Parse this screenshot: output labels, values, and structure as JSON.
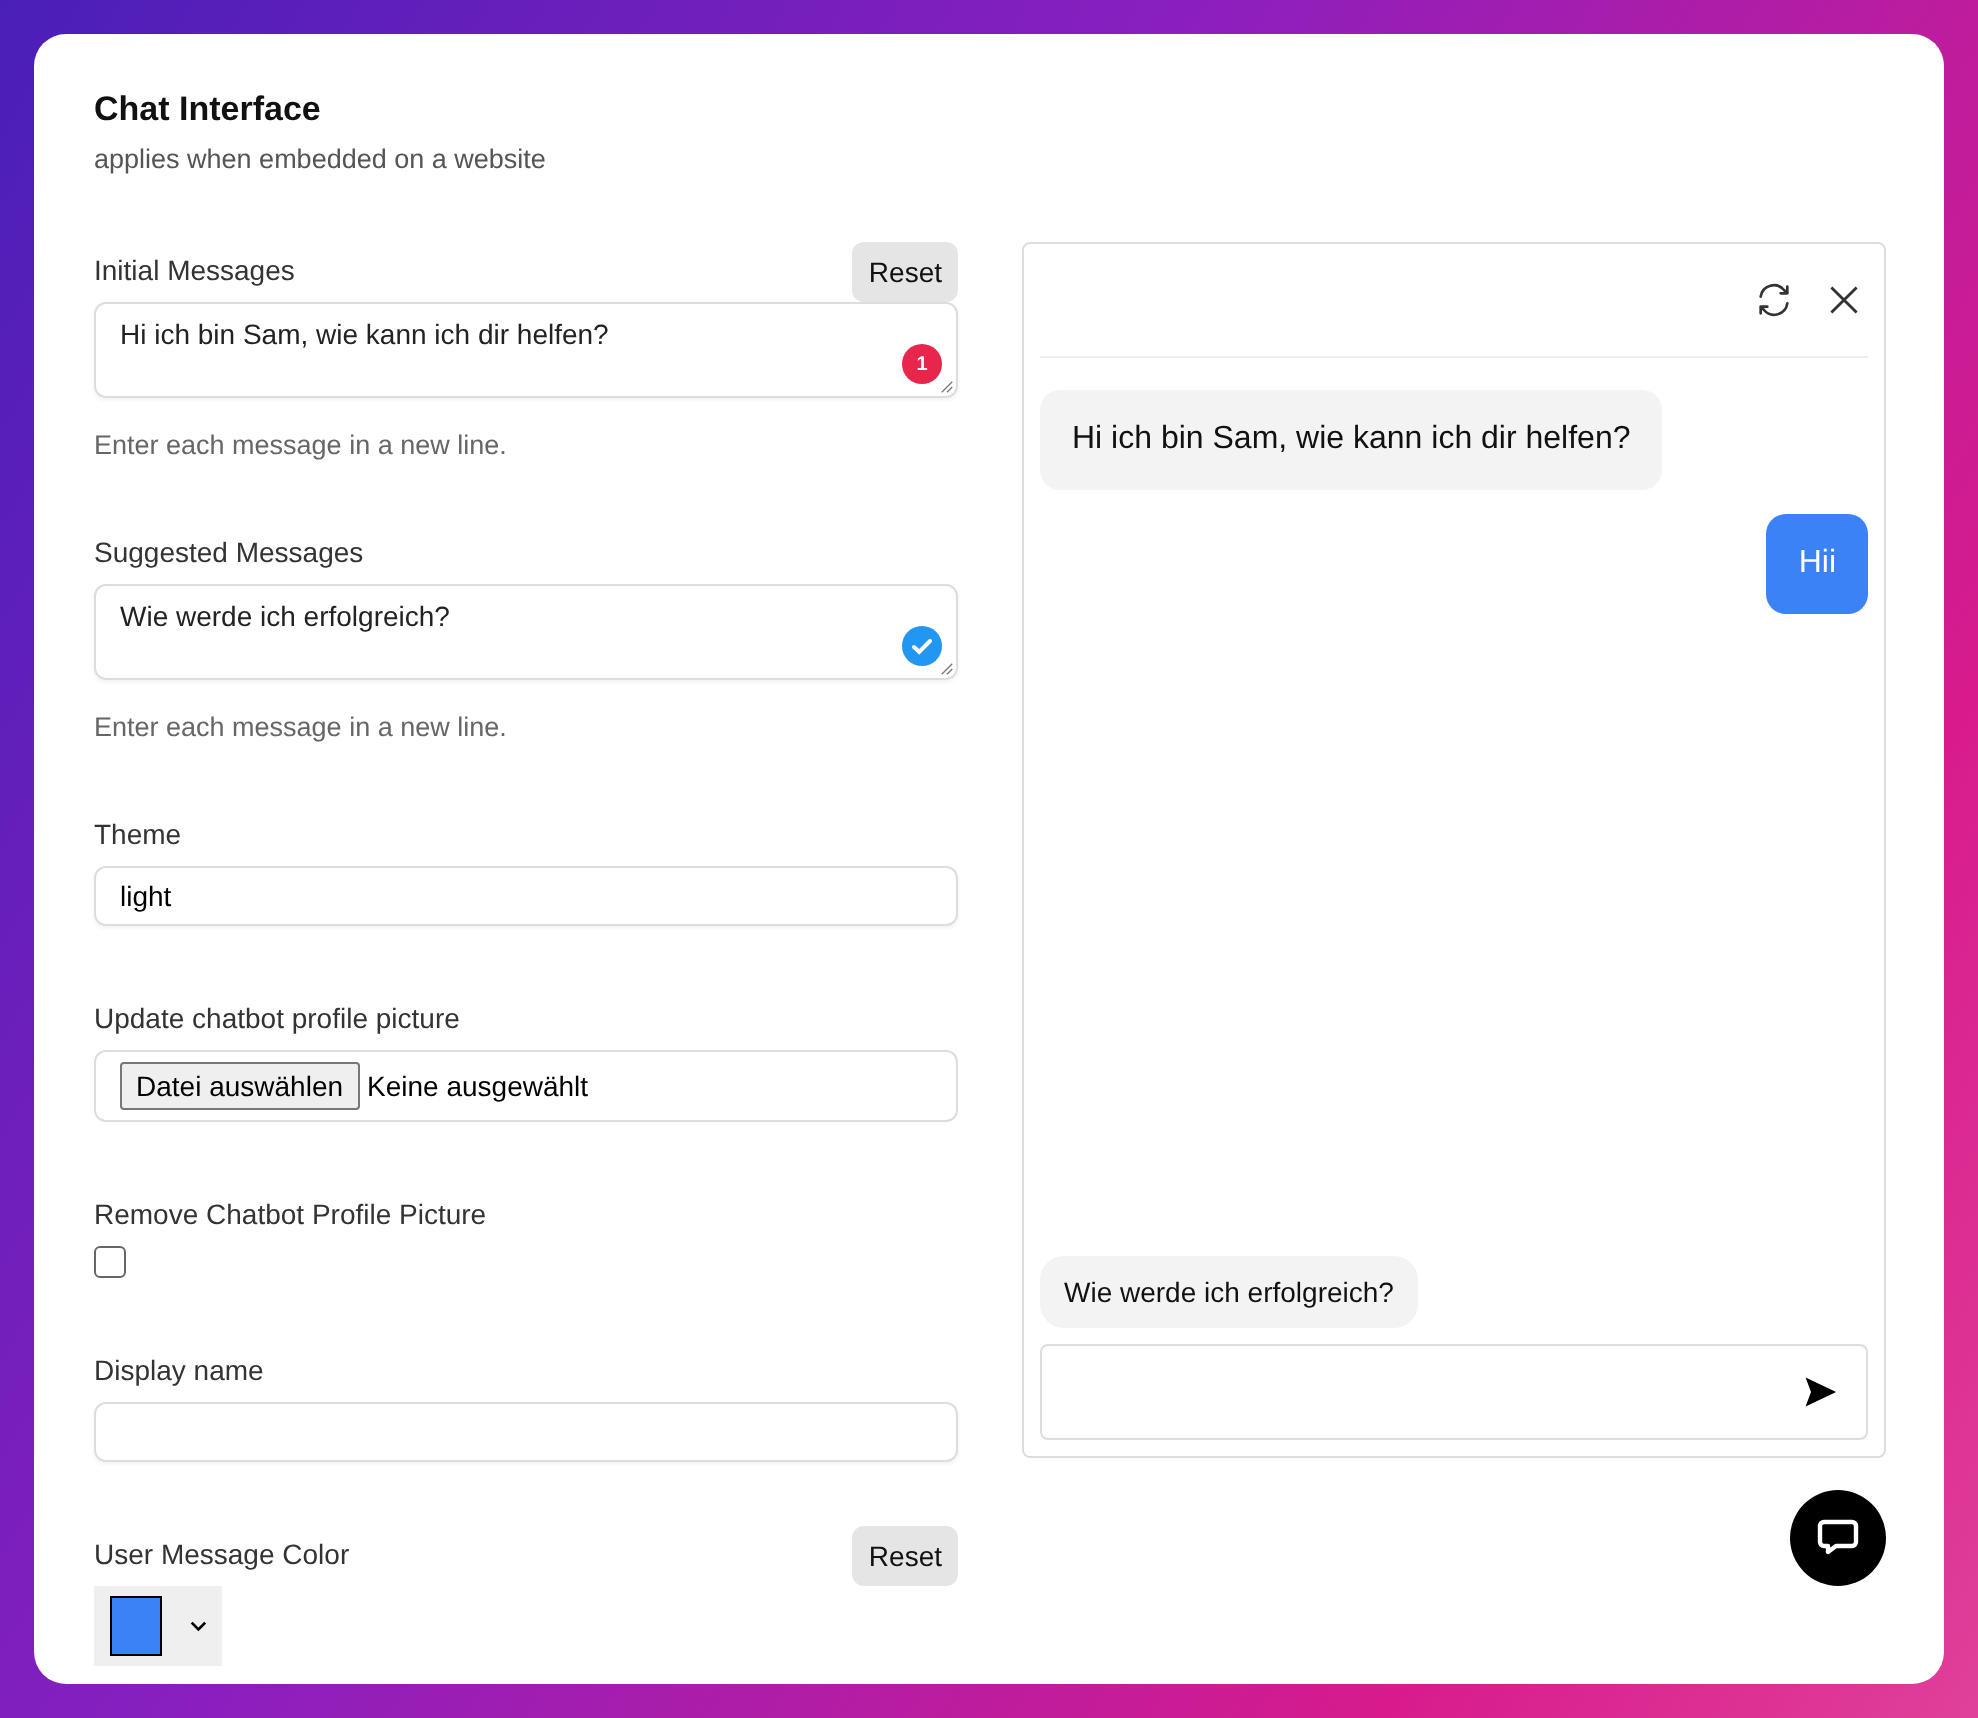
{
  "header": {
    "title": "Chat Interface",
    "subtitle": "applies when embedded on a website"
  },
  "fields": [
    {
      "kind": "textarea",
      "label": "Initial Messages",
      "value": "Hi ich bin Sam, wie kann ich dir helfen?",
      "reset": "Reset",
      "badge": {
        "kind": "count",
        "text": "1"
      },
      "hint": "Enter each message in a new line."
    },
    {
      "kind": "textarea",
      "label": "Suggested Messages",
      "value": "Wie werde ich erfolgreich?",
      "badge": {
        "kind": "ok"
      },
      "hint": "Enter each message in a new line."
    },
    {
      "kind": "text",
      "label": "Theme",
      "value": "light"
    },
    {
      "kind": "file",
      "label": "Update chatbot profile picture",
      "button": "Datei auswählen",
      "status": "Keine ausgewählt"
    },
    {
      "kind": "checkbox",
      "label": "Remove Chatbot Profile Picture",
      "checked": false
    },
    {
      "kind": "text",
      "label": "Display name"
    },
    {
      "kind": "color",
      "label": "User Message Color",
      "reset": "Reset",
      "color": "#3b82f6"
    }
  ],
  "chat": {
    "messages": [
      {
        "kind": "bot",
        "text": "Hi ich bin Sam, wie kann ich dir helfen?"
      },
      {
        "kind": "user",
        "text": "Hii"
      }
    ],
    "suggestions": [
      "Wie werde ich erfolgreich?"
    ]
  }
}
